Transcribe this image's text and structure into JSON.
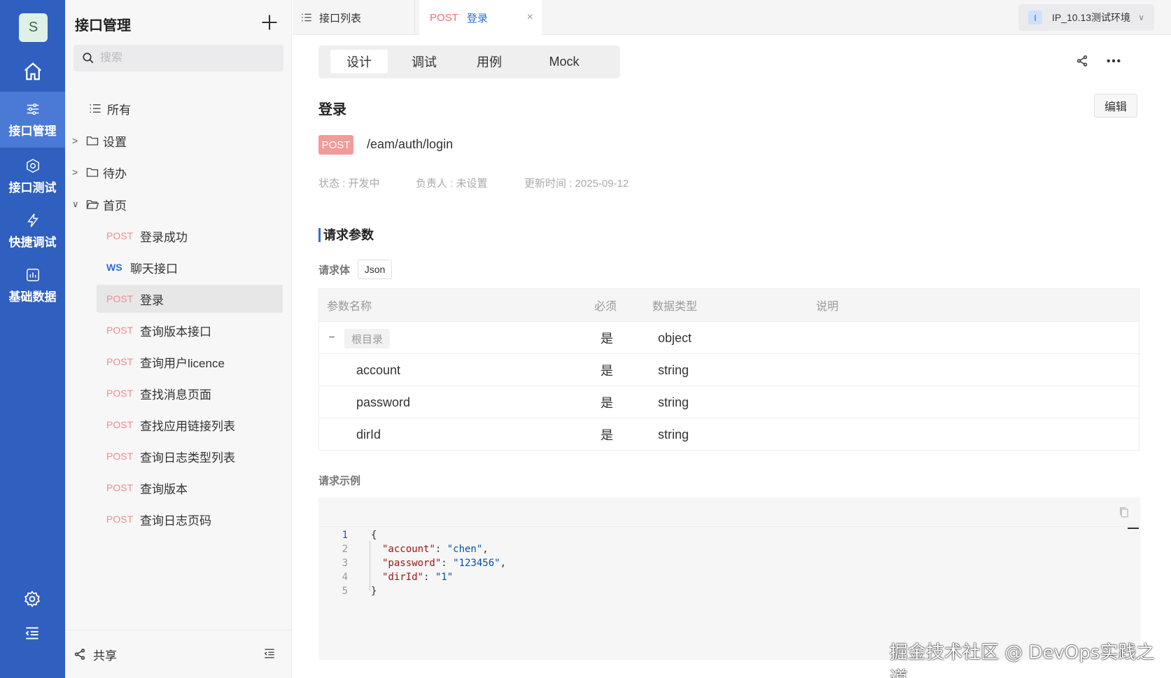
{
  "rail": {
    "avatar": "S",
    "items": [
      {
        "label": "接口管理",
        "icon": "sliders-icon",
        "active": true
      },
      {
        "label": "接口测试",
        "icon": "hexagon-icon",
        "active": false
      },
      {
        "label": "快捷调试",
        "icon": "lightning-icon",
        "active": false
      },
      {
        "label": "基础数据",
        "icon": "chart-icon",
        "active": false
      }
    ]
  },
  "tree": {
    "title": "接口管理",
    "search_placeholder": "搜索",
    "all_label": "所有",
    "folders": [
      {
        "label": "设置",
        "expanded": false
      },
      {
        "label": "待办",
        "expanded": false
      },
      {
        "label": "首页",
        "expanded": true
      }
    ],
    "items": [
      {
        "method": "POST",
        "name": "登录成功"
      },
      {
        "method": "WS",
        "name": "聊天接口"
      },
      {
        "method": "POST",
        "name": "登录",
        "selected": true
      },
      {
        "method": "POST",
        "name": "查询版本接口"
      },
      {
        "method": "POST",
        "name": "查询用户licence"
      },
      {
        "method": "POST",
        "name": "查找消息页面"
      },
      {
        "method": "POST",
        "name": "查找应用链接列表"
      },
      {
        "method": "POST",
        "name": "查询日志类型列表"
      },
      {
        "method": "POST",
        "name": "查询版本"
      },
      {
        "method": "POST",
        "name": "查询日志页码"
      }
    ],
    "footer_share": "共享"
  },
  "tabs": {
    "list_label": "接口列表",
    "active_method": "POST",
    "active_name": "登录",
    "close": "×"
  },
  "env": {
    "tag": "I",
    "name": "IP_10.13测试环境"
  },
  "segments": [
    "设计",
    "调试",
    "用例",
    "Mock"
  ],
  "api": {
    "name": "登录",
    "edit_label": "编辑",
    "method": "POST",
    "path": "/eam/auth/login",
    "status": "状态 : 开发中",
    "owner": "负责人 : 未设置",
    "updated": "更新时间 : 2025-09-12"
  },
  "request": {
    "section_title": "请求参数",
    "body_label": "请求体",
    "body_type": "Json",
    "columns": [
      "参数名称",
      "必须",
      "数据类型",
      "说明"
    ],
    "root": {
      "name": "根目录",
      "required": "是",
      "type": "object",
      "collapse": "−"
    },
    "params": [
      {
        "name": "account",
        "required": "是",
        "type": "string"
      },
      {
        "name": "password",
        "required": "是",
        "type": "string"
      },
      {
        "name": "dirId",
        "required": "是",
        "type": "string"
      }
    ]
  },
  "example": {
    "label": "请求示例",
    "lines": [
      {
        "n": "1",
        "open": "{"
      },
      {
        "n": "2",
        "key": "\"account\"",
        "val": "\"chen\"",
        "tail": ","
      },
      {
        "n": "3",
        "key": "\"password\"",
        "val": "\"123456\"",
        "tail": ","
      },
      {
        "n": "4",
        "key": "\"dirId\"",
        "val": "\"1\"",
        "tail": ""
      },
      {
        "n": "5",
        "open": "}"
      }
    ]
  },
  "watermark": "掘金技术社区 @ DevOps实践之道",
  "colors": {
    "rail": "#2f5fbf",
    "accent": "#2f6fd6",
    "post": "#f28b8b"
  }
}
